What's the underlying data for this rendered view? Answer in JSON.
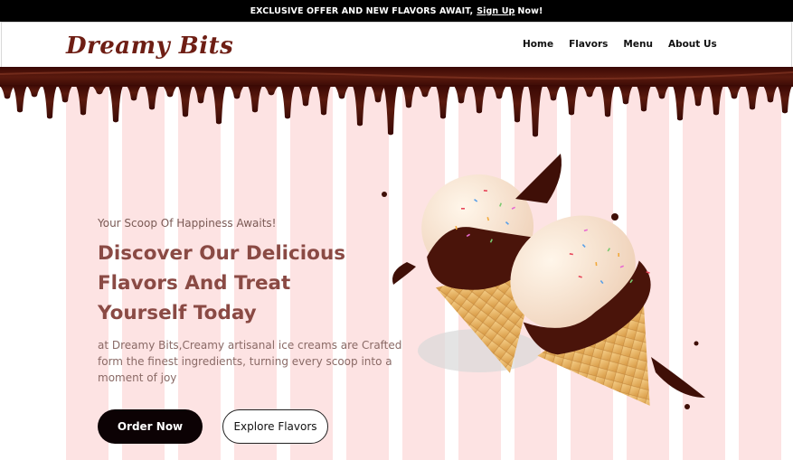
{
  "announcement": {
    "text": "EXCLUSIVE OFFER AND NEW FLAVORS AWAIT,",
    "link": "Sign Up",
    "after": "Now!"
  },
  "brand": {
    "logo": "Dreamy Bits"
  },
  "nav": {
    "items": [
      "Home",
      "Flavors",
      "Menu",
      "About Us"
    ]
  },
  "hero": {
    "eyebrow": "Your Scoop Of Happiness Awaits!",
    "headline": "Discover Our Delicious Flavors And Treat Yourself Today",
    "description": "at Dreamy Bits,Creamy artisanal ice creams are Crafted form the finest ingredients, turning every scoop into a moment of joy",
    "primary_button": "Order Now",
    "secondary_button": "Explore Flavors"
  },
  "colors": {
    "stripe": "#fde3e3",
    "chocolate": "#4a0f08",
    "brand_text": "#6e1e14",
    "headline": "#8a4a44",
    "primary_button": "#0c0204"
  },
  "icons": [
    "chocolate-drip",
    "ice-cream-cone-image"
  ]
}
